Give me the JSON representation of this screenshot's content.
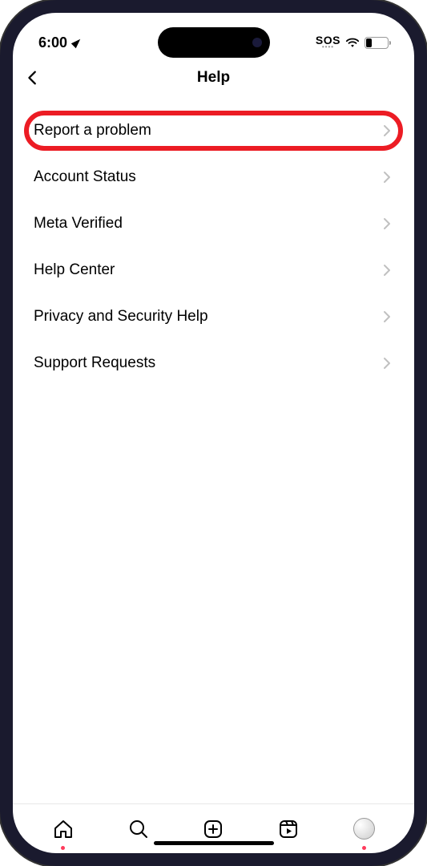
{
  "status": {
    "time": "6:00",
    "sos": "SOS",
    "battery_percent": "27"
  },
  "header": {
    "title": "Help"
  },
  "menu": {
    "items": [
      {
        "label": "Report a problem",
        "highlighted": true
      },
      {
        "label": "Account Status",
        "highlighted": false
      },
      {
        "label": "Meta Verified",
        "highlighted": false
      },
      {
        "label": "Help Center",
        "highlighted": false
      },
      {
        "label": "Privacy and Security Help",
        "highlighted": false
      },
      {
        "label": "Support Requests",
        "highlighted": false
      }
    ]
  }
}
